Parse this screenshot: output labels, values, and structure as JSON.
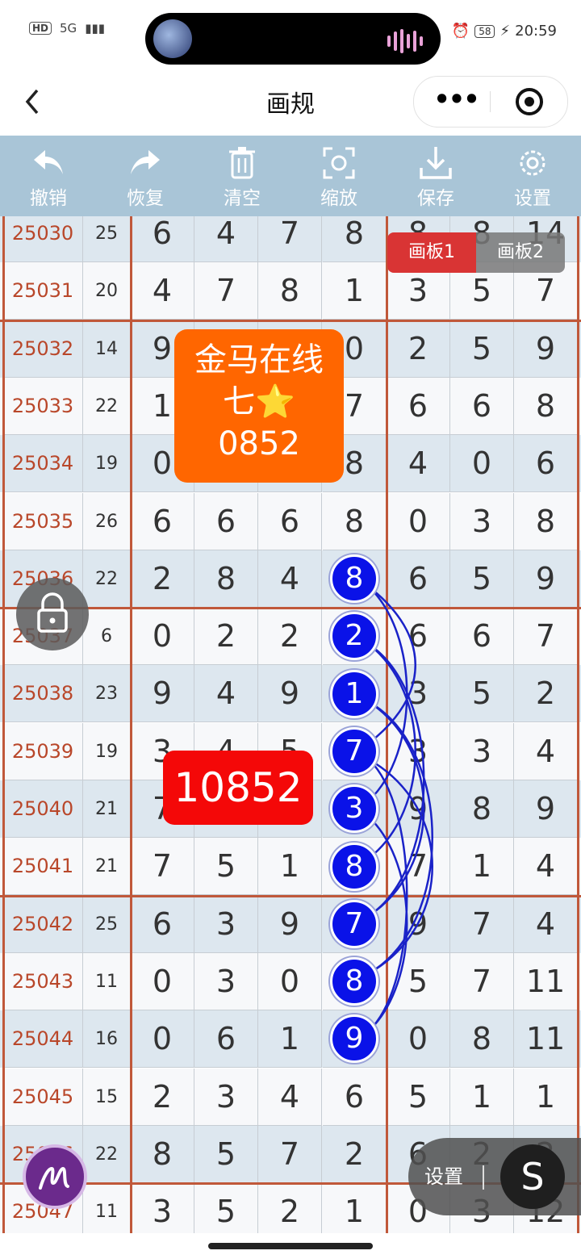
{
  "status_bar": {
    "hd": "HD",
    "network": "5G",
    "battery": "58",
    "time": "20:59"
  },
  "nav": {
    "title": "画规"
  },
  "toolbar": [
    {
      "label": "撤销",
      "icon": "undo-icon"
    },
    {
      "label": "恢复",
      "icon": "redo-icon"
    },
    {
      "label": "清空",
      "icon": "trash-icon"
    },
    {
      "label": "缩放",
      "icon": "zoom-icon"
    },
    {
      "label": "保存",
      "icon": "download-icon"
    },
    {
      "label": "设置",
      "icon": "gear-icon"
    }
  ],
  "tabs": {
    "board1": "画板1",
    "board2": "画板2"
  },
  "promo": {
    "line1": "金马在线",
    "line2": "七",
    "star": "⭐",
    "line3": "0852"
  },
  "red_box": "10852",
  "float_control": {
    "settings": "设置",
    "s": "S"
  },
  "colors": {
    "toolbar": "#a9c5d7",
    "circle": "#0a12e8",
    "promo": "#ff6600",
    "red_box": "#f40808",
    "divider": "#c0583a"
  },
  "rows": [
    {
      "id": "25030",
      "sum": "25",
      "d": [
        "6",
        "4",
        "7",
        "8",
        "8",
        "8",
        "14"
      ]
    },
    {
      "id": "25031",
      "sum": "20",
      "d": [
        "4",
        "7",
        "8",
        "1",
        "3",
        "5",
        "7"
      ]
    },
    {
      "id": "25032",
      "sum": "14",
      "d": [
        "9",
        "",
        "",
        "0",
        "2",
        "5",
        "9"
      ]
    },
    {
      "id": "25033",
      "sum": "22",
      "d": [
        "1",
        "",
        "",
        "7",
        "6",
        "6",
        "8"
      ]
    },
    {
      "id": "25034",
      "sum": "19",
      "d": [
        "0",
        "",
        "",
        "8",
        "4",
        "0",
        "6"
      ]
    },
    {
      "id": "25035",
      "sum": "26",
      "d": [
        "6",
        "6",
        "6",
        "8",
        "0",
        "3",
        "8"
      ]
    },
    {
      "id": "25036",
      "sum": "22",
      "d": [
        "2",
        "8",
        "4",
        "",
        "6",
        "5",
        "9"
      ]
    },
    {
      "id": "25037",
      "sum": "6",
      "d": [
        "0",
        "2",
        "2",
        "",
        "6",
        "6",
        "7"
      ]
    },
    {
      "id": "25038",
      "sum": "23",
      "d": [
        "9",
        "4",
        "9",
        "",
        "3",
        "5",
        "2"
      ]
    },
    {
      "id": "25039",
      "sum": "19",
      "d": [
        "3",
        "4",
        "5",
        "",
        "3",
        "3",
        "4"
      ]
    },
    {
      "id": "25040",
      "sum": "21",
      "d": [
        "7",
        "",
        "",
        "",
        "9",
        "8",
        "9"
      ]
    },
    {
      "id": "25041",
      "sum": "21",
      "d": [
        "7",
        "5",
        "1",
        "",
        "7",
        "1",
        "4"
      ]
    },
    {
      "id": "25042",
      "sum": "25",
      "d": [
        "6",
        "3",
        "9",
        "",
        "9",
        "7",
        "4"
      ]
    },
    {
      "id": "25043",
      "sum": "11",
      "d": [
        "0",
        "3",
        "0",
        "",
        "5",
        "7",
        "11"
      ]
    },
    {
      "id": "25044",
      "sum": "16",
      "d": [
        "0",
        "6",
        "1",
        "",
        "0",
        "8",
        "11"
      ]
    },
    {
      "id": "25045",
      "sum": "15",
      "d": [
        "2",
        "3",
        "4",
        "6",
        "5",
        "1",
        "1"
      ]
    },
    {
      "id": "25046",
      "sum": "22",
      "d": [
        "8",
        "5",
        "7",
        "2",
        "6",
        "2",
        "2"
      ]
    },
    {
      "id": "25047",
      "sum": "11",
      "d": [
        "3",
        "5",
        "2",
        "1",
        "0",
        "3",
        "12"
      ]
    }
  ],
  "circled": [
    "8",
    "2",
    "1",
    "7",
    "3",
    "8",
    "7",
    "8",
    "9"
  ]
}
